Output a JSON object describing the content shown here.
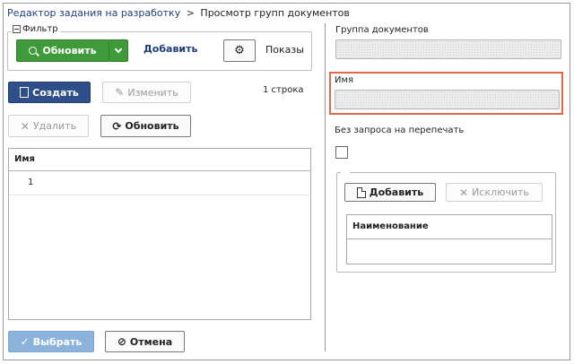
{
  "breadcrumb": {
    "link": "Редактор задания на разработку",
    "separator": ">",
    "current": "Просмотр групп документов"
  },
  "filter": {
    "legend": "Фильтр",
    "refresh_label": "Обновить",
    "add_label": "Добавить",
    "show_label": "Показы"
  },
  "toolbar": {
    "create_label": "Создать",
    "edit_label": "Изменить",
    "row_count": "1 строка",
    "delete_label": "Удалить",
    "refresh_label": "Обновить"
  },
  "grid": {
    "column_name": "Имя",
    "rows": [
      {
        "name": "1"
      }
    ]
  },
  "footer": {
    "select_label": "Выбрать",
    "cancel_label": "Отмена"
  },
  "detail": {
    "group_label": "Группа документов",
    "group_value": "",
    "name_label": "Имя",
    "name_value": "",
    "no_reprint_label": "Без запроса на перепечать",
    "no_reprint_checked": false,
    "sub_add_label": "Добавить",
    "sub_exclude_label": "Исключить",
    "sub_column_name": "Наименование"
  },
  "colors": {
    "primary": "#2e4f8a",
    "success": "#3f9b3a",
    "highlight": "#e06a48",
    "link": "#1f3e7a"
  }
}
